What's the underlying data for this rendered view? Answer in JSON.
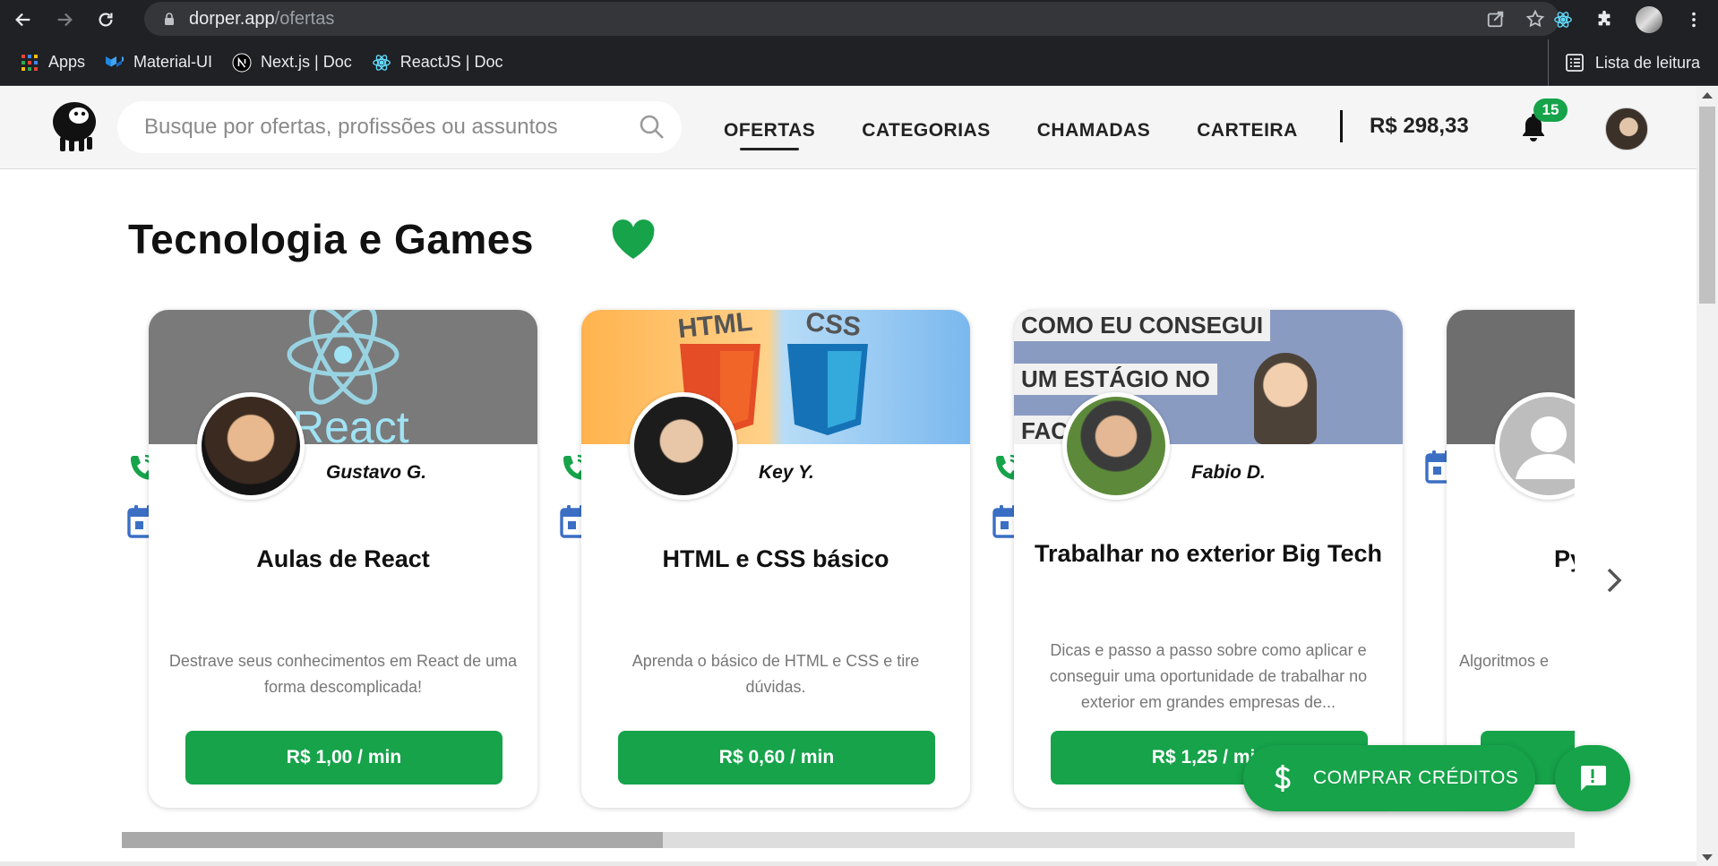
{
  "browser": {
    "url_host": "dorper.app",
    "url_path": "/ofertas",
    "bookmarks": [
      {
        "label": "Apps",
        "icon": "apps-grid-icon"
      },
      {
        "label": "Material-UI",
        "icon": "material-ui-icon"
      },
      {
        "label": "Next.js | Doc",
        "icon": "nextjs-icon"
      },
      {
        "label": "ReactJS | Doc",
        "icon": "react-icon"
      }
    ],
    "reading_list": "Lista de leitura"
  },
  "header": {
    "search_placeholder": "Busque por ofertas, profissões ou assuntos",
    "nav": [
      "OFERTAS",
      "CATEGORIAS",
      "CHAMADAS",
      "CARTEIRA"
    ],
    "active_nav": "OFERTAS",
    "balance": "R$ 298,33",
    "notifications": "15"
  },
  "section": {
    "title": "Tecnologia e Games",
    "accent_color": "#16a34a"
  },
  "cards": [
    {
      "banner_text": "React",
      "name": "Gustavo G.",
      "title": "Aulas de React",
      "desc": "Destrave seus conhecimentos em React de uma forma descomplicada!",
      "price": "R$ 1,00 / min"
    },
    {
      "banner_text_1": "HTML",
      "banner_text_2": "CSS",
      "name": "Key Y.",
      "title": "HTML e CSS básico",
      "desc": "Aprenda o básico de HTML e CSS e tire dúvidas.",
      "price": "R$ 0,60 / min"
    },
    {
      "banner_line_1": "COMO EU CONSEGUI",
      "banner_line_2": "UM ESTÁGIO NO",
      "banner_line_3": "FACE",
      "name": "Fabio D.",
      "title": "Trabalhar no exterior Big Tech",
      "desc": "Dicas e passo a passo sobre como aplicar e conseguir uma oportunidade de trabalhar no exterior em grandes empresas de...",
      "price": "R$ 1,25 / min"
    },
    {
      "title": "Py",
      "desc": "Algoritmos e"
    }
  ],
  "buy_button": "COMPRAR CRÉDITOS"
}
